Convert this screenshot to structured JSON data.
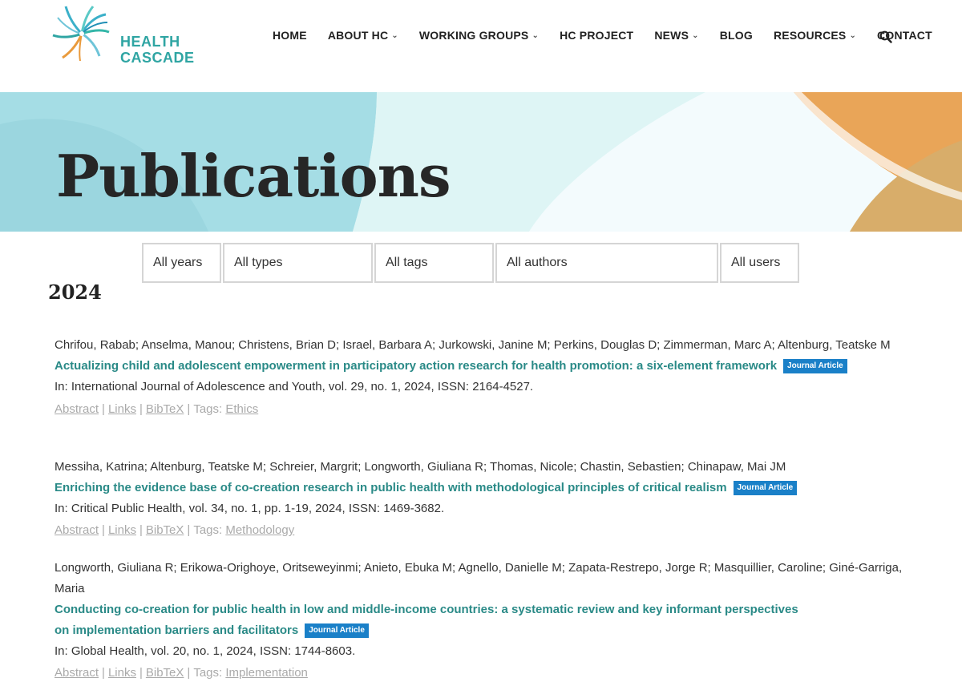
{
  "logo": {
    "line1": "HEALTH",
    "line2": "CASCADE"
  },
  "nav": [
    {
      "label": "HOME",
      "dropdown": false
    },
    {
      "label": "ABOUT HC",
      "dropdown": true
    },
    {
      "label": "WORKING GROUPS",
      "dropdown": true
    },
    {
      "label": "HC PROJECT",
      "dropdown": false
    },
    {
      "label": "NEWS",
      "dropdown": true
    },
    {
      "label": "BLOG",
      "dropdown": false
    },
    {
      "label": "RESOURCES",
      "dropdown": true
    },
    {
      "label": "CONTACT",
      "dropdown": false
    }
  ],
  "search_icon": "search-icon",
  "hero": {
    "title": "Publications"
  },
  "filters": {
    "years": "All years",
    "types": "All types",
    "tags": "All tags",
    "authors": "All authors",
    "users": "All users"
  },
  "year_heading": "2024",
  "publications": [
    {
      "authors": "Chrifou, Rabab; Anselma, Manou; Christens, Brian D; Israel, Barbara A; Jurkowski, Janine M; Perkins, Douglas D; Zimmerman, Marc A; Altenburg, Teatske M",
      "title": "Actualizing child and adolescent empowerment in participatory action research for health promotion: a six-element framework",
      "type": "Journal Article",
      "venue": "In: International Journal of Adolescence and Youth, vol. 29, no. 1, 2024, ISSN: 2164-4527.",
      "abstract": "Abstract",
      "links": "Links",
      "bibtex": "BibTeX",
      "tags_label": "Tags:",
      "tag": "Ethics"
    },
    {
      "authors": "Messiha, Katrina; Altenburg, Teatske M; Schreier, Margrit; Longworth, Giuliana R; Thomas, Nicole; Chastin, Sebastien; Chinapaw, Mai JM",
      "title": "Enriching the evidence base of co-creation research in public health with methodological principles of critical realism",
      "type": "Journal Article",
      "venue": "In: Critical Public Health, vol. 34, no. 1, pp. 1-19, 2024, ISSN: 1469-3682.",
      "abstract": "Abstract",
      "links": "Links",
      "bibtex": "BibTeX",
      "tags_label": "Tags:",
      "tag": "Methodology"
    },
    {
      "authors": "Longworth, Giuliana R; Erikowa-Orighoye, Oritseweyinmi; Anieto, Ebuka M; Agnello, Danielle M; Zapata-Restrepo, Jorge R; Masquillier, Caroline; Giné-Garriga, Maria",
      "title": "Conducting co-creation for public health in low and middle-income countries: a systematic review and key informant perspectives on implementation barriers and facilitators",
      "type": "Journal Article",
      "venue": "In: Global Health, vol. 20, no. 1, 2024, ISSN: 1744-8603.",
      "abstract": "Abstract",
      "links": "Links",
      "bibtex": "BibTeX",
      "tags_label": "Tags:",
      "tag": "Implementation"
    }
  ]
}
